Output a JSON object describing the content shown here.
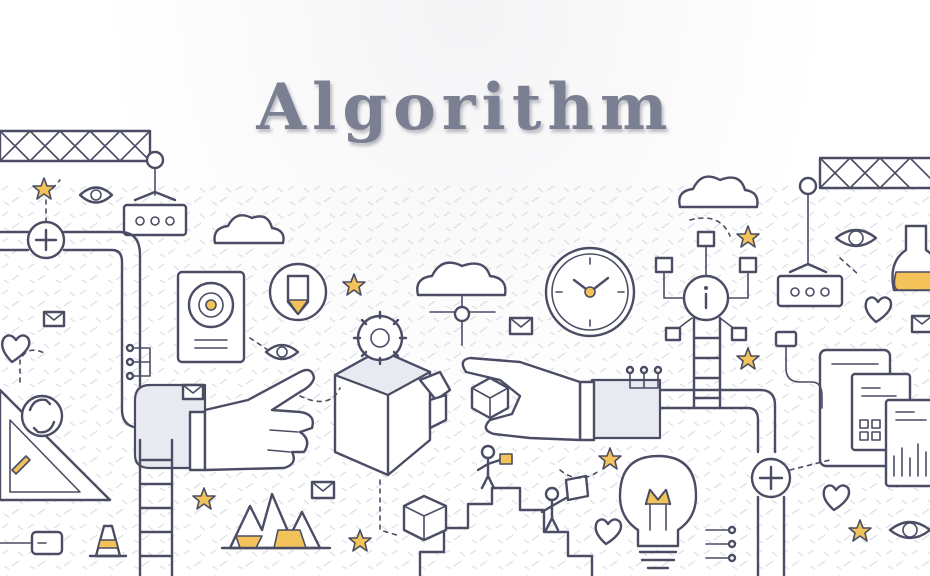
{
  "title": "Algorithm",
  "colors": {
    "line": "#4a4d63",
    "title": "#7b7f92",
    "accent": "#f3c35a",
    "fill_light": "#e9eaf1"
  },
  "icons": [
    "crane-icon",
    "hand-icon",
    "cube-icon",
    "gear-icon",
    "clock-icon",
    "cloud-icon",
    "lightbulb-icon",
    "ladder-icon",
    "eye-icon",
    "star-icon",
    "envelope-icon",
    "heart-icon",
    "plus-icon",
    "speaker-icon",
    "pencil-icon",
    "info-icon",
    "flask-icon",
    "refresh-icon",
    "mountain-chart-icon",
    "phone-icon",
    "document-icon",
    "traffic-cone-icon",
    "plug-icon",
    "person-icon"
  ]
}
